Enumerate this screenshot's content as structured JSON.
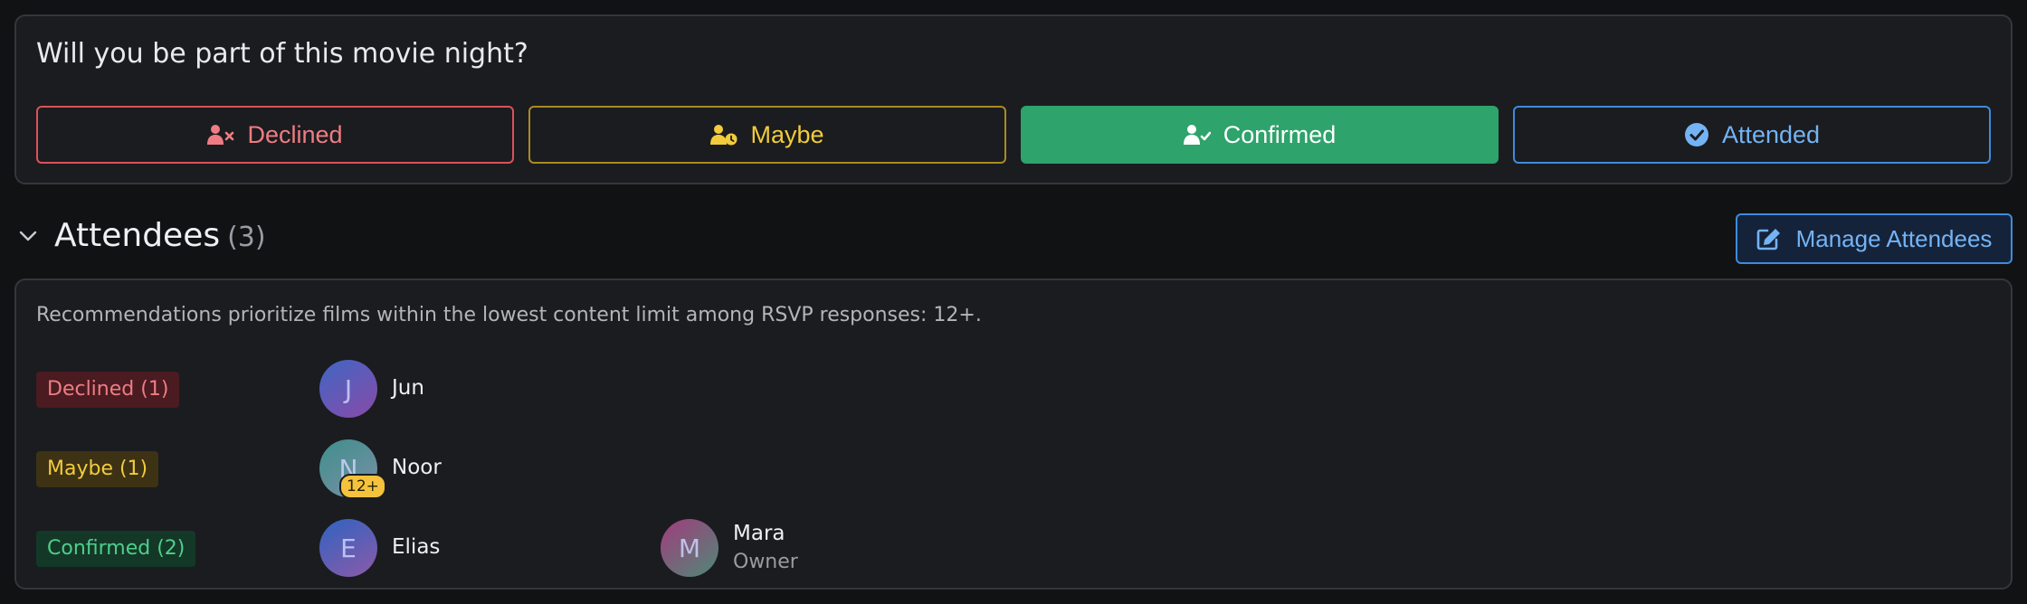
{
  "rsvp": {
    "question": "Will you be part of this movie night?",
    "buttons": {
      "declined": "Declined",
      "maybe": "Maybe",
      "confirmed": "Confirmed",
      "attended": "Attended"
    },
    "selected": "confirmed",
    "icons": {
      "declined": "user-xmark-icon",
      "maybe": "user-clock-icon",
      "confirmed": "user-check-icon",
      "attended": "circle-check-icon"
    }
  },
  "attendees": {
    "title": "Attendees",
    "count": "(3)",
    "manage_label": "Manage Attendees",
    "note": "Recommendations prioritize films within the lowest content limit among RSVP responses: 12+.",
    "groups": {
      "declined": {
        "label": "Declined (1)",
        "people": [
          {
            "initial": "J",
            "name": "Jun"
          }
        ]
      },
      "maybe": {
        "label": "Maybe (1)",
        "people": [
          {
            "initial": "N",
            "name": "Noor",
            "age_badge": "12+"
          }
        ]
      },
      "confirmed": {
        "label": "Confirmed (2)",
        "people": [
          {
            "initial": "E",
            "name": "Elias"
          },
          {
            "initial": "M",
            "name": "Mara",
            "role": "Owner"
          }
        ]
      }
    }
  },
  "colors": {
    "declined": "#ef7c84",
    "maybe": "#f2cc3c",
    "confirmed": "#2ea36b",
    "attended": "#74b3f4",
    "card_bg": "#1b1c1f"
  }
}
